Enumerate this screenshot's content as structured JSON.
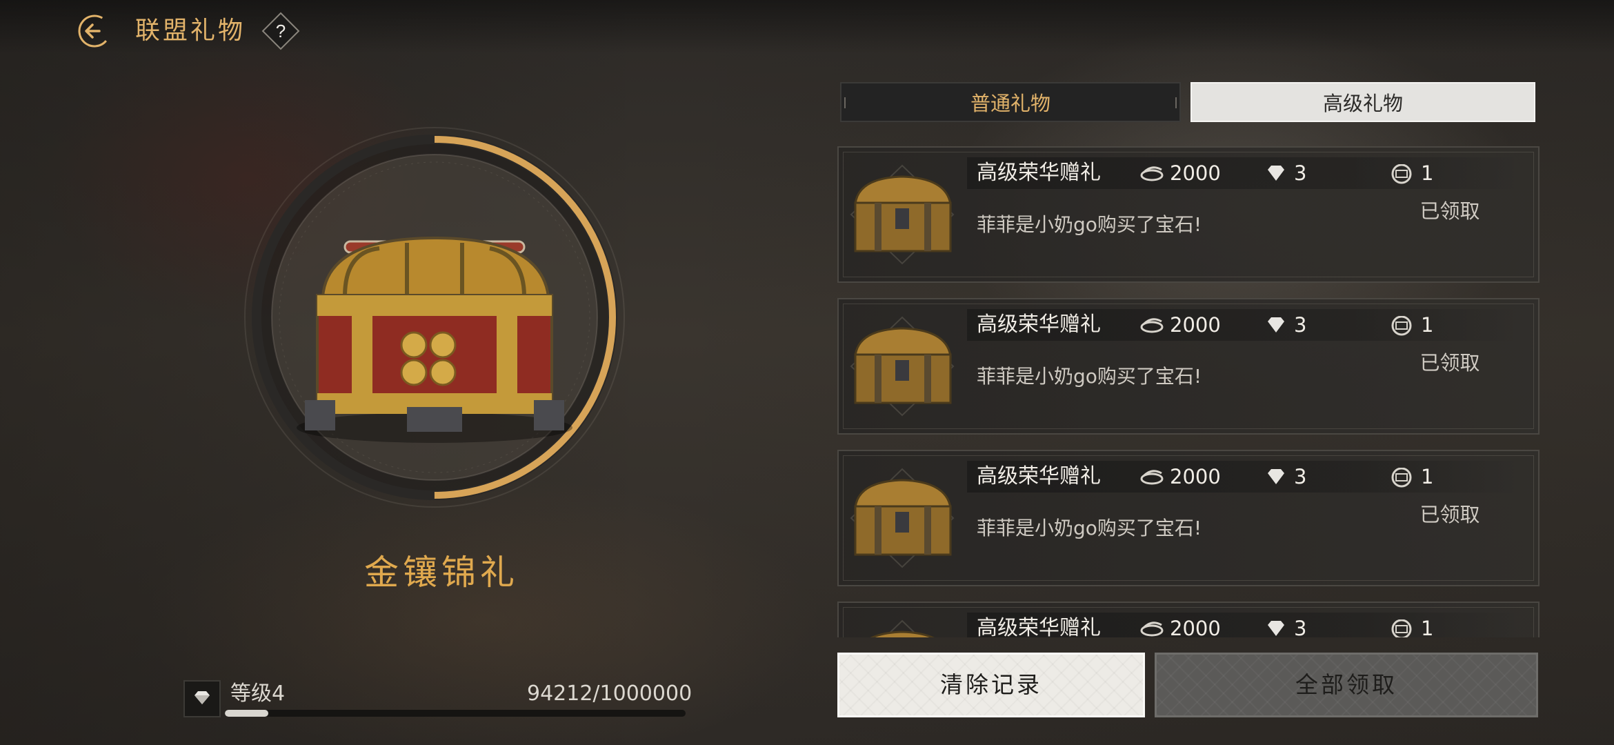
{
  "header": {
    "title": "联盟礼物",
    "help_label": "?",
    "back_icon": "back-arrow-icon"
  },
  "colors": {
    "accent_gold": "#e2b36a",
    "gift_name": "#e0a94e",
    "tab_active_bg": "#e4e3e0",
    "tab_inactive_bg": "#232323"
  },
  "featured_gift": {
    "name": "金镶锦礼",
    "icon": "treasure-chest-icon",
    "ring_progress": 0.5
  },
  "level": {
    "label": "等级4",
    "progress_text": "94212/1000000",
    "current": 94212,
    "max": 1000000,
    "icon": "diamond-icon"
  },
  "tabs": [
    {
      "label": "普通礼物",
      "active": false
    },
    {
      "label": "高级礼物",
      "active": true
    }
  ],
  "gift_list": [
    {
      "title": "高级荣华赠礼",
      "coins": "2000",
      "gems": "3",
      "tickets": "1",
      "message": "菲菲是小奶go购买了宝石!",
      "status": "已领取"
    },
    {
      "title": "高级荣华赠礼",
      "coins": "2000",
      "gems": "3",
      "tickets": "1",
      "message": "菲菲是小奶go购买了宝石!",
      "status": "已领取"
    },
    {
      "title": "高级荣华赠礼",
      "coins": "2000",
      "gems": "3",
      "tickets": "1",
      "message": "菲菲是小奶go购买了宝石!",
      "status": "已领取"
    },
    {
      "title": "高级荣华赠礼",
      "coins": "2000",
      "gems": "3",
      "tickets": "1",
      "message": "",
      "status": ""
    }
  ],
  "actions": {
    "clear_label": "清除记录",
    "claim_all_label": "全部领取"
  }
}
